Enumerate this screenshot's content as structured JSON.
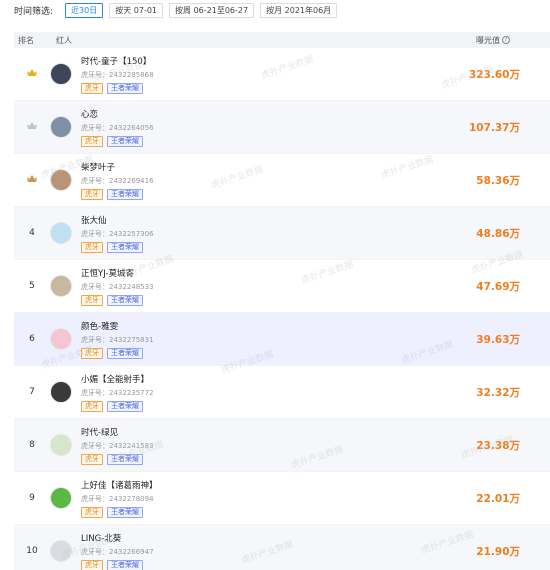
{
  "filter": {
    "label": "时间筛选:",
    "buttons": [
      {
        "label": "近30日",
        "active": true
      },
      {
        "label": "按天 07-01",
        "active": false
      },
      {
        "label": "按周 06-21至06-27",
        "active": false
      },
      {
        "label": "按月 2021年06月",
        "active": false
      }
    ]
  },
  "table": {
    "col_rank": "排名",
    "col_name": "红人",
    "col_exp": "曝光值"
  },
  "watermark": "虎扑产业数据",
  "uid_prefix": "虎牙号：",
  "rows": [
    {
      "rank": "",
      "crown": "gold",
      "name": "时代-童子【150】",
      "uid": "2432285868",
      "tags": [
        "虎牙",
        "王者荣耀"
      ],
      "exp": "323.60万",
      "avatar": "#3b4658"
    },
    {
      "rank": "",
      "crown": "silver",
      "name": "心恋",
      "uid": "2432264056",
      "tags": [
        "虎牙",
        "王者荣耀"
      ],
      "exp": "107.37万",
      "avatar": "#7f8fa6"
    },
    {
      "rank": "",
      "crown": "bronze",
      "name": "柴梦叶子",
      "uid": "2432269416",
      "tags": [
        "虎牙",
        "王者荣耀"
      ],
      "exp": "58.36万",
      "avatar": "#b89478"
    },
    {
      "rank": "4",
      "crown": "",
      "name": "张大仙",
      "uid": "2432257306",
      "tags": [
        "虎牙",
        "王者荣耀"
      ],
      "exp": "48.86万",
      "avatar": "#bfe0f2"
    },
    {
      "rank": "5",
      "crown": "",
      "name": "正恒YJ-莫城寄",
      "uid": "2432248533",
      "tags": [
        "虎牙",
        "王者荣耀"
      ],
      "exp": "47.69万",
      "avatar": "#c9b8a0"
    },
    {
      "rank": "6",
      "crown": "",
      "name": "颜色-雅雯",
      "uid": "2432275831",
      "tags": [
        "虎牙",
        "王者荣耀"
      ],
      "exp": "39.63万",
      "avatar": "#f4c5d2"
    },
    {
      "rank": "7",
      "crown": "",
      "name": "小媚【全能射手】",
      "uid": "2432235772",
      "tags": [
        "虎牙",
        "王者荣耀"
      ],
      "exp": "32.32万",
      "avatar": "#3a3a3a"
    },
    {
      "rank": "8",
      "crown": "",
      "name": "时代-绿见",
      "uid": "2432241583",
      "tags": [
        "虎牙",
        "王者荣耀"
      ],
      "exp": "23.38万",
      "avatar": "#d7e6c8"
    },
    {
      "rank": "9",
      "crown": "",
      "name": "上好佳【诸葛雨神】",
      "uid": "2432278094",
      "tags": [
        "虎牙",
        "王者荣耀"
      ],
      "exp": "22.01万",
      "avatar": "#5cb845"
    },
    {
      "rank": "10",
      "crown": "",
      "name": "LING-北葵",
      "uid": "2432266947",
      "tags": [
        "虎牙",
        "王者荣耀"
      ],
      "exp": "21.90万",
      "avatar": "#d8dde3"
    }
  ]
}
